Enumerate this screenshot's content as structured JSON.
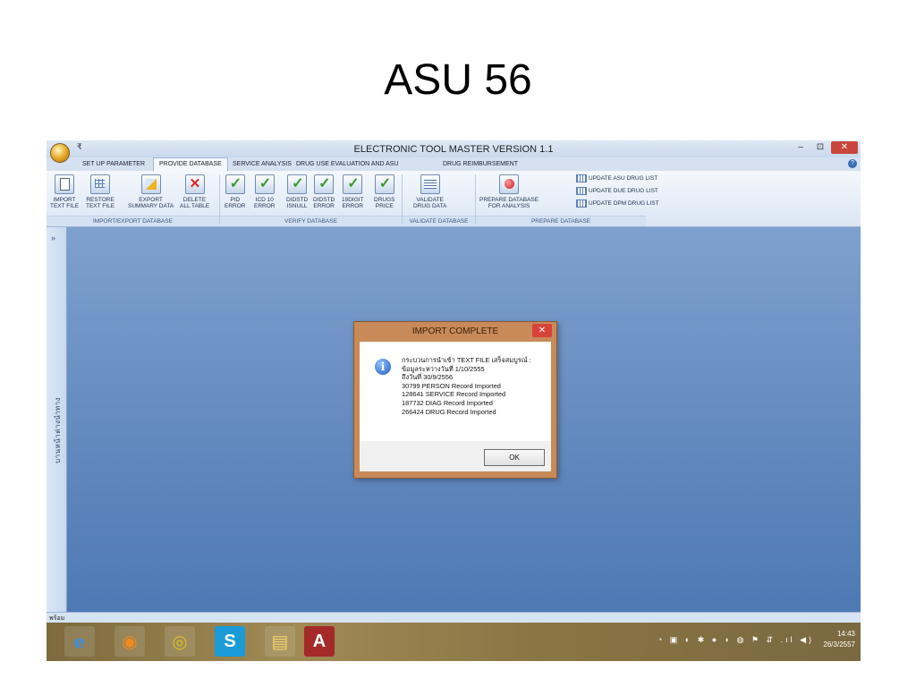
{
  "slide_title": "ASU 56",
  "window": {
    "title": "ELECTRONIC TOOL MASTER VERSION 1.1",
    "qat_symbol": "₹",
    "minimize": "–",
    "restore": "⊡",
    "close": "✕"
  },
  "tabs": [
    {
      "label": "SET UP PARAMETER"
    },
    {
      "label": "PROVIDE DATABASE"
    },
    {
      "label": "SERVICE ANALYSIS"
    },
    {
      "label": "DRUG USE EVALUATION AND ASU"
    },
    {
      "label": "DRUG REIMBURSEMENT"
    }
  ],
  "active_tab": "PROVIDE DATABASE",
  "ribbon": {
    "buttons": [
      {
        "line1": "IMPORT",
        "line2": "TEXT FILE",
        "icon": "import-icon"
      },
      {
        "line1": "RESTORE",
        "line2": "TEXT FILE",
        "icon": "restore-icon"
      },
      {
        "line1": "EXPORT",
        "line2": "SUMMARY DATA",
        "icon": "export-icon"
      },
      {
        "line1": "DELETE",
        "line2": "ALL TABLE",
        "icon": "delete-icon"
      },
      {
        "line1": "PID",
        "line2": "ERROR",
        "icon": "check-icon"
      },
      {
        "line1": "ICD 10",
        "line2": "ERROR",
        "icon": "check-icon"
      },
      {
        "line1": "DIDSTD",
        "line2": "ISNULL",
        "icon": "check-icon"
      },
      {
        "line1": "DIDSTD",
        "line2": "ERROR",
        "icon": "check-icon"
      },
      {
        "line1": "19DIGIT",
        "line2": "ERROR",
        "icon": "check-icon"
      },
      {
        "line1": "DRUGS",
        "line2": "PRICE",
        "icon": "check-icon"
      },
      {
        "line1": "VALIDATE",
        "line2": "DRUG DATA",
        "icon": "validate-icon"
      },
      {
        "line1": "PREPARE DATABASE",
        "line2": "FOR ANALYSIS",
        "icon": "prepare-icon"
      }
    ],
    "small_buttons": [
      {
        "label": "UPDATE ASU DRUG LIST"
      },
      {
        "label": "UPDATE DUE DRUG LIST"
      },
      {
        "label": "UPDATE DPM DRUG LIST"
      }
    ],
    "groups": [
      {
        "label": "IMPORT/EXPORT DATABASE"
      },
      {
        "label": "VERIFY DATABASE"
      },
      {
        "label": "VALIDATE DATABASE"
      },
      {
        "label": "PREPARE DATABASE"
      }
    ]
  },
  "nav_pane": {
    "toggle": "»",
    "label": "บานหน้าต่างนำทาง"
  },
  "status": {
    "text": "พร้อม"
  },
  "dialog": {
    "title": "IMPORT COMPLETE",
    "close": "✕",
    "icon_glyph": "i",
    "lines": [
      "กระบวนการนำเข้า TEXT FILE เสร็จสมบูรณ์ :",
      "ข้อมูลระหว่างวันที่ 1/10/2555",
      "ถึงวันที่ 30/9/2556",
      "30799 PERSON Record Imported",
      "128641 SERVICE Record Imported",
      "187732 DIAG Record Imported",
      "266424 DRUG Record Imported"
    ],
    "ok_label": "OK"
  },
  "taskbar": {
    "items": [
      {
        "icon": "internet-explorer-icon",
        "glyph": "e"
      },
      {
        "icon": "firefox-icon",
        "glyph": "◉"
      },
      {
        "icon": "chrome-icon",
        "glyph": "◎"
      },
      {
        "icon": "skype-icon",
        "glyph": "S"
      },
      {
        "icon": "file-explorer-icon",
        "glyph": "▤"
      },
      {
        "icon": "access-icon",
        "glyph": "A"
      }
    ],
    "tray_icons": "◔ ▣ ◐ ✱ ● ◖ ◍ ⚑ ⇵ .ıl ◀)",
    "time": "14:43",
    "date": "26/3/2557"
  },
  "colors": {
    "workarea": "#6a8fc2",
    "dialog_frame": "#c78a58",
    "close_button": "#d7433a"
  }
}
